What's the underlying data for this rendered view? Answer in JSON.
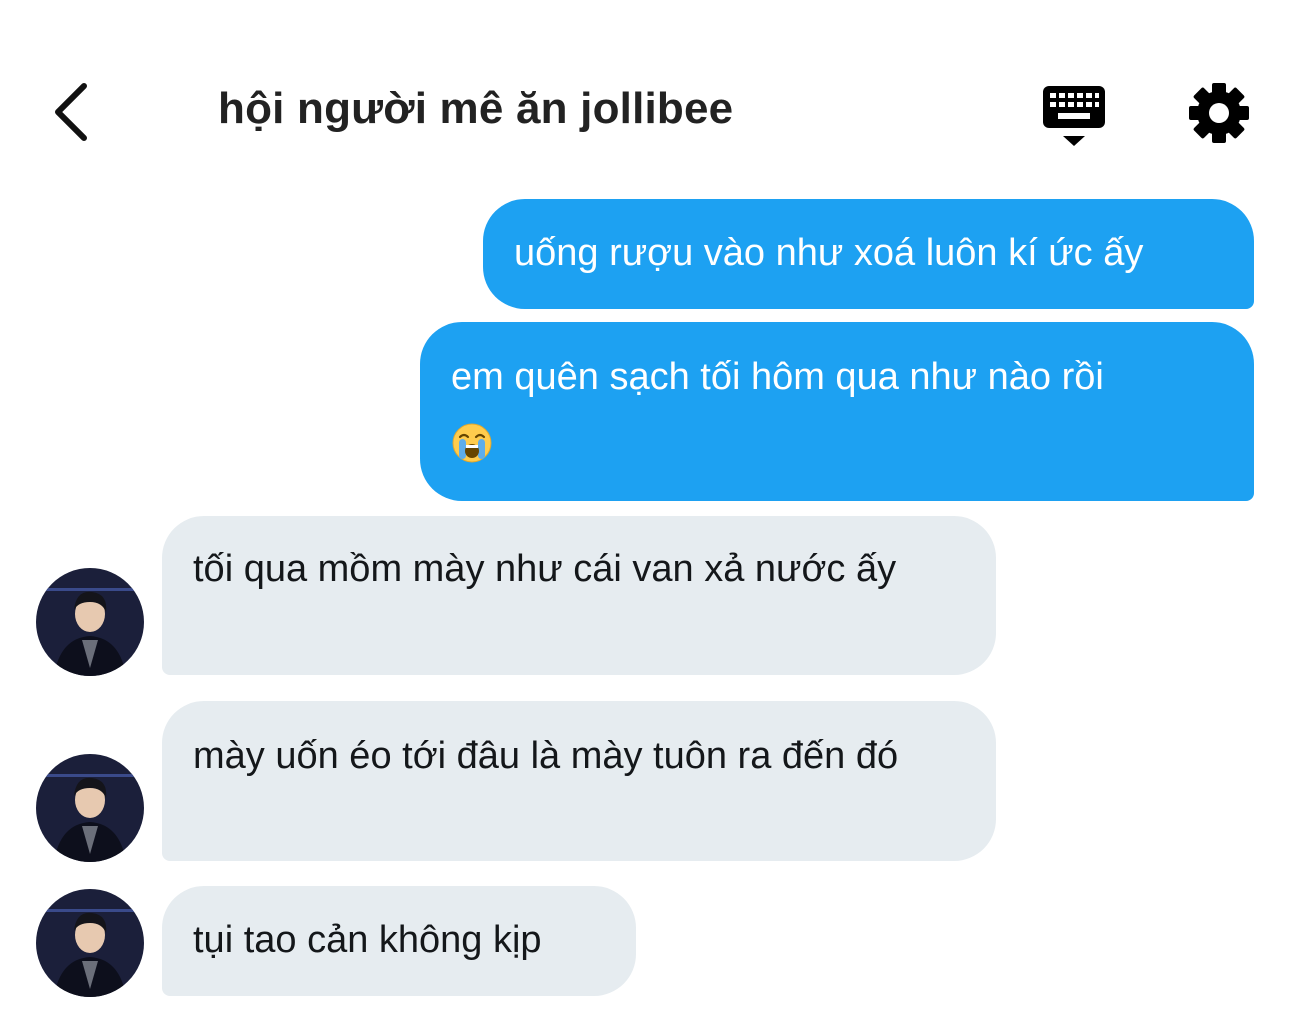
{
  "header": {
    "title": "hội người mê ăn jollibee"
  },
  "messages": [
    {
      "direction": "outgoing",
      "text": "uống rượu vào như xoá luôn kí ức ấy"
    },
    {
      "direction": "outgoing",
      "text": "em quên sạch tối hôm qua như nào rồi",
      "emoji": "loudly-crying-face"
    },
    {
      "direction": "incoming",
      "text": "tối qua mồm mày như cái van xả nước ấy"
    },
    {
      "direction": "incoming",
      "text": "mày uốn éo tới đâu là mày tuôn ra đến đó"
    },
    {
      "direction": "incoming",
      "text": "tụi tao cản không kịp"
    }
  ],
  "colors": {
    "outgoing_bubble": "#1da1f2",
    "incoming_bubble": "#e6ecf0",
    "header_icons": "#000000"
  }
}
